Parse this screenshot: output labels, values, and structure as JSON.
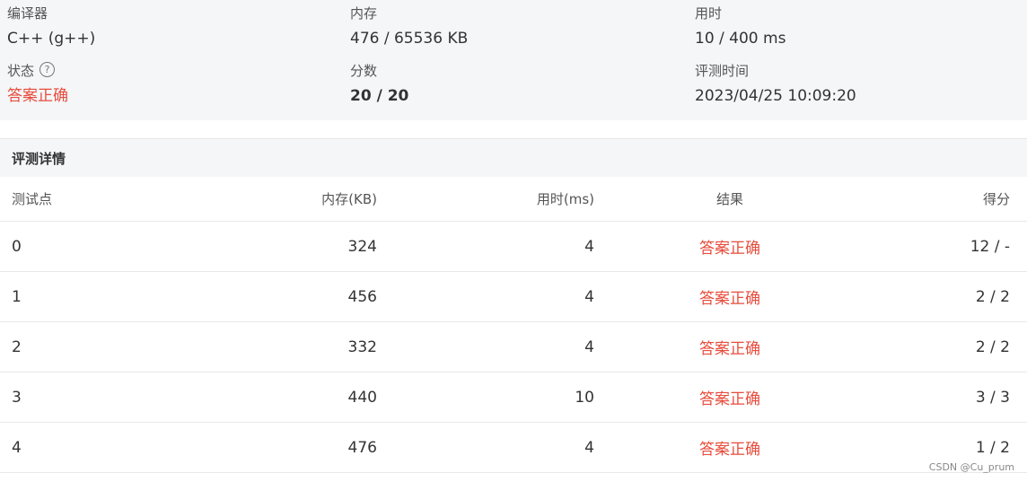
{
  "summary": {
    "compiler_label": "编译器",
    "compiler_value": "C++ (g++)",
    "memory_label": "内存",
    "memory_value": "476 / 65536 KB",
    "time_label": "用时",
    "time_value": "10 / 400 ms",
    "status_label": "状态",
    "status_help_icon": "question-circle-icon",
    "status_value": "答案正确",
    "score_label": "分数",
    "score_value": "20 / 20",
    "judge_time_label": "评测时间",
    "judge_time_value": "2023/04/25 10:09:20"
  },
  "details": {
    "title": "评测详情",
    "headers": [
      "测试点",
      "内存(KB)",
      "用时(ms)",
      "结果",
      "得分"
    ],
    "rows": [
      {
        "case": "0",
        "memory": "324",
        "time": "4",
        "result": "答案正确",
        "score": "12 / -"
      },
      {
        "case": "1",
        "memory": "456",
        "time": "4",
        "result": "答案正确",
        "score": "2 / 2"
      },
      {
        "case": "2",
        "memory": "332",
        "time": "4",
        "result": "答案正确",
        "score": "2 / 2"
      },
      {
        "case": "3",
        "memory": "440",
        "time": "10",
        "result": "答案正确",
        "score": "3 / 3"
      },
      {
        "case": "4",
        "memory": "476",
        "time": "4",
        "result": "答案正确",
        "score": "1 / 2"
      }
    ]
  },
  "colors": {
    "accepted": "#e74c3c",
    "panel_bg": "#f5f6f8"
  },
  "watermark": "CSDN @Cu_prum"
}
